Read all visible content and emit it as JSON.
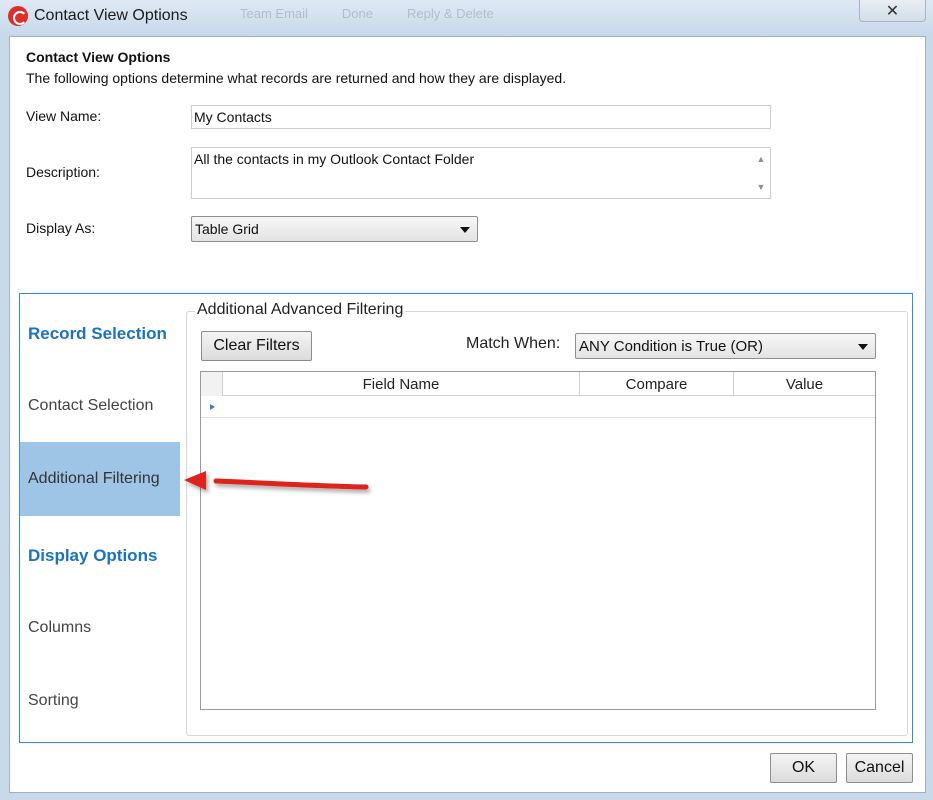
{
  "window": {
    "title": "Contact View Options",
    "close_glyph": "✕",
    "background_toolbar": [
      "Team Email",
      "Done",
      "Reply & Delete"
    ]
  },
  "header": {
    "title": "Contact View Options",
    "description": "The following options determine what records are returned and how they are displayed."
  },
  "form": {
    "view_name_label": "View Name:",
    "view_name_value": "My Contacts",
    "description_label": "Description:",
    "description_value": "All the contacts in my Outlook Contact Folder",
    "display_as_label": "Display As:",
    "display_as_value": "Table Grid"
  },
  "nav": {
    "record_selection_header": "Record Selection",
    "contact_selection": "Contact Selection",
    "additional_filtering": "Additional Filtering",
    "display_options_header": "Display Options",
    "columns": "Columns",
    "sorting": "Sorting"
  },
  "filtering": {
    "group_title": "Additional Advanced Filtering",
    "clear_filters_label": "Clear Filters",
    "match_when_label": "Match When:",
    "match_when_value": "ANY Condition is True (OR)",
    "columns": [
      "Field Name",
      "Compare",
      "Value"
    ]
  },
  "footer": {
    "ok_label": "OK",
    "cancel_label": "Cancel"
  },
  "colors": {
    "accent": "#1a73c0",
    "panel_border": "#2f8fd8",
    "selected_nav": "#9ec5e5",
    "annotation_arrow": "#e0201a"
  }
}
